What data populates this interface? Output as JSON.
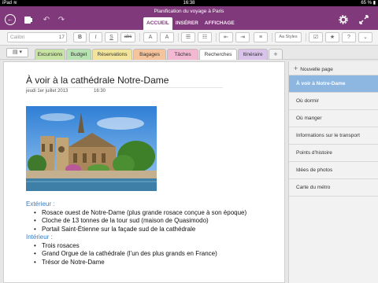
{
  "status_bar": {
    "device": "iPad",
    "wifi_icon": "wifi-icon",
    "time": "16:38",
    "battery": "65 %"
  },
  "top_bar": {
    "document_title": "Planification du voyage à Paris",
    "ribbon_tabs": [
      {
        "label": "ACCUEIL",
        "active": true
      },
      {
        "label": "INSÉRER",
        "active": false
      },
      {
        "label": "AFFICHAGE",
        "active": false
      }
    ]
  },
  "ribbon": {
    "font_name": "Calibri",
    "font_size": "17",
    "buttons": [
      "B",
      "I",
      "S",
      "abc",
      "A",
      "A",
      "Styles"
    ]
  },
  "section_tabs": [
    {
      "label": "Excursions",
      "color": "#c8e4a5",
      "active": false
    },
    {
      "label": "Budget",
      "color": "#b7e2b1",
      "active": false
    },
    {
      "label": "Réservations",
      "color": "#f2e59b",
      "active": false
    },
    {
      "label": "Bagages",
      "color": "#f5c49c",
      "active": false
    },
    {
      "label": "Tâches",
      "color": "#f3b9d2",
      "active": false
    },
    {
      "label": "Recherches",
      "color": "#ffffff",
      "active": true
    },
    {
      "label": "Itinéraire",
      "color": "#d9c3ea",
      "active": false
    }
  ],
  "page": {
    "title": "À voir à la cathédrale Notre-Dame",
    "date": "jeudi 1er juillet 2013",
    "time": "16:30",
    "image_alt": "Cathédrale Notre-Dame",
    "sections": [
      {
        "heading": "Extérieur :",
        "items": [
          "Rosace ouest de Notre-Dame (plus grande rosace conçue à son époque)",
          "Cloche de 13 tonnes de la tour sud (maison de Quasimodo)",
          "Portail Saint-Étienne sur la façade sud de la cathédrale"
        ]
      },
      {
        "heading": "Intérieur :",
        "items": [
          "Trois rosaces",
          "Grand Orgue de la cathédrale (l’un des plus grands en France)",
          "Trésor de Notre-Dame"
        ]
      }
    ]
  },
  "page_list": {
    "new_page_label": "Nouvelle page",
    "items": [
      {
        "label": "À voir à Notre-Dame",
        "active": true
      },
      {
        "label": "Où dormir",
        "active": false
      },
      {
        "label": "Où manger",
        "active": false
      },
      {
        "label": "Informations sur le transport",
        "active": false
      },
      {
        "label": "Points d’histoire",
        "active": false
      },
      {
        "label": "Idées de photos",
        "active": false
      },
      {
        "label": "Carte du métro",
        "active": false
      }
    ]
  },
  "colors": {
    "accent": "#80397b",
    "selected_page": "#8db7e0",
    "heading": "#3a7bbf"
  }
}
